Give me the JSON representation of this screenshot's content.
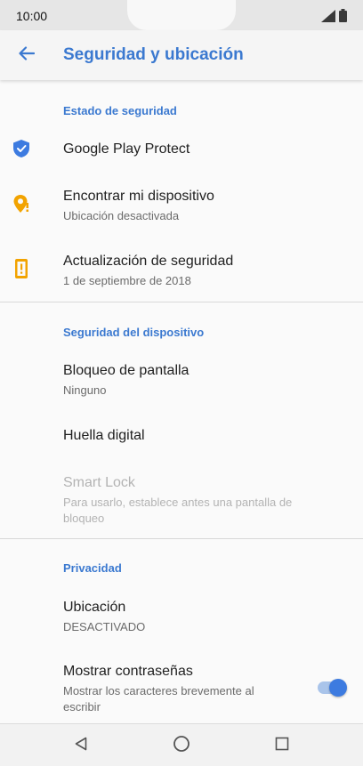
{
  "status_bar": {
    "time": "10:00",
    "icons": [
      "signal-icon",
      "battery-icon"
    ]
  },
  "app_bar": {
    "back_icon": "arrow-back-icon",
    "title": "Seguridad y ubicación"
  },
  "sections": {
    "security_status": {
      "header": "Estado de seguridad",
      "items": [
        {
          "title": "Google Play Protect",
          "icon": "shield-check-icon"
        },
        {
          "title": "Encontrar mi dispositivo",
          "subtitle": "Ubicación desactivada",
          "icon": "find-device-icon"
        },
        {
          "title": "Actualización de seguridad",
          "subtitle": "1 de septiembre de 2018",
          "icon": "security-update-alert-icon"
        }
      ]
    },
    "device_security": {
      "header": "Seguridad del dispositivo",
      "items": [
        {
          "title": "Bloqueo de pantalla",
          "subtitle": "Ninguno"
        },
        {
          "title": "Huella digital"
        },
        {
          "title": "Smart Lock",
          "subtitle": "Para usarlo, establece antes una pantalla de bloqueo",
          "disabled": true
        }
      ]
    },
    "privacy": {
      "header": "Privacidad",
      "items": [
        {
          "title": "Ubicación",
          "subtitle": "DESACTIVADO"
        },
        {
          "title": "Mostrar contraseñas",
          "subtitle": "Mostrar los caracteres brevemente al escribir",
          "toggle_on": true
        }
      ]
    }
  },
  "nav_bar": {
    "buttons": [
      "back-triangle-icon",
      "home-circle-icon",
      "recents-square-icon"
    ]
  },
  "colors": {
    "accent": "#3b79d0",
    "shield_blue": "#3d7be0",
    "warning_amber": "#f2a300",
    "toggle_track": "#a9c4ea"
  }
}
